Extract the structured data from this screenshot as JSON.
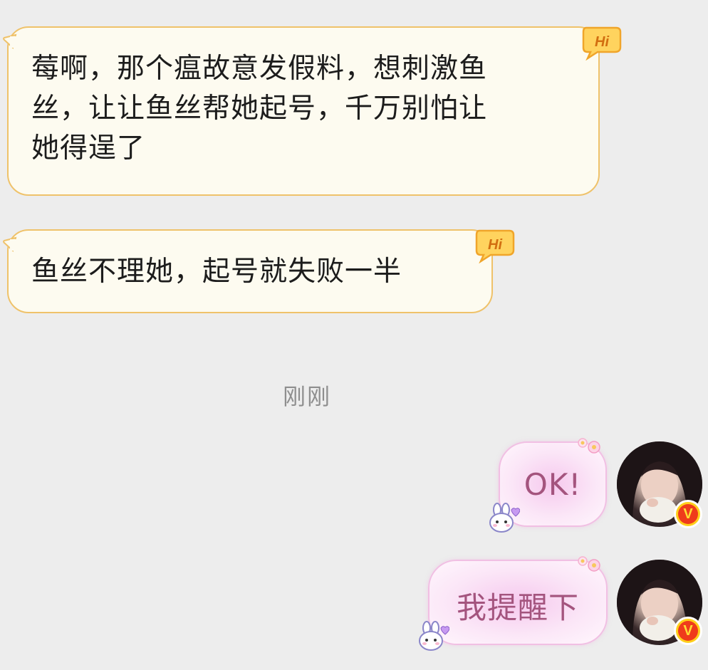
{
  "messages_in": [
    {
      "lines": [
        "莓啊，那个瘟故意发假料，想刺激鱼",
        "丝，让让鱼丝帮她起号，千万别怕让",
        "她得逞了"
      ],
      "badge": "Hi"
    },
    {
      "lines": [
        "鱼丝不理她，起号就失败一半"
      ],
      "badge": "Hi"
    }
  ],
  "timestamp": "刚刚",
  "messages_out": [
    {
      "text": "OK!",
      "verified_badge": "V"
    },
    {
      "text": "我提醒下",
      "verified_badge": "V"
    }
  ],
  "icons": {
    "hi_badge": "hi-speech-icon",
    "bunny": "bunny-sticker-icon",
    "flower": "flower-deco-icon",
    "verified": "verified-v-icon"
  },
  "colors": {
    "background": "#ededed",
    "incoming_bubble": "#fdfbf0",
    "incoming_border": "#efc26a",
    "outgoing_bubble": "#fbe6f7",
    "outgoing_text": "#a4547e",
    "timestamp": "#8e8e8e",
    "badge_orange": "#f5a623",
    "verified_red": "#ef3b1b",
    "verified_yellow": "#ffcf1a"
  }
}
